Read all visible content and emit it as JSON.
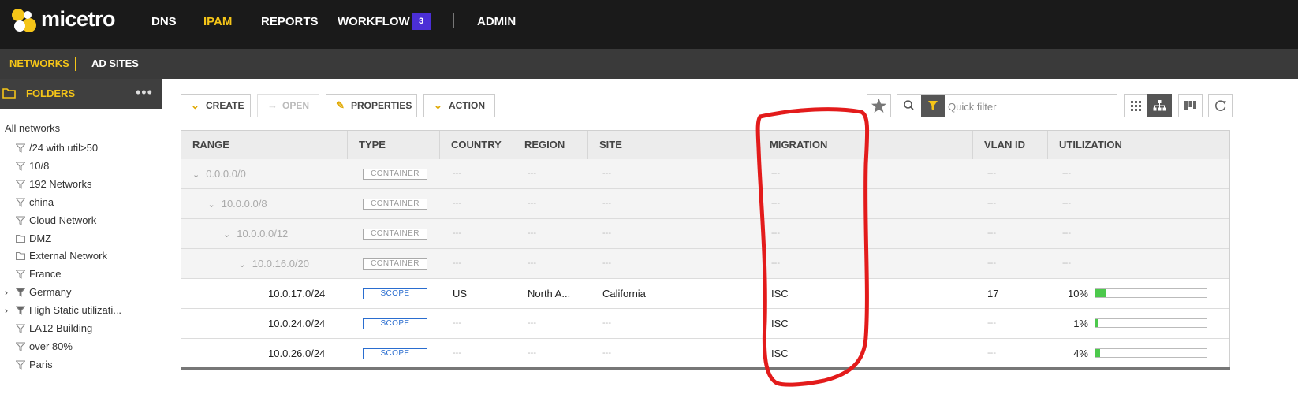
{
  "app": {
    "name": "micetro"
  },
  "nav": {
    "items": [
      "DNS",
      "IPAM",
      "REPORTS",
      "WORKFLOW",
      "ADMIN"
    ],
    "active": "IPAM",
    "workflow_badge": "3"
  },
  "subnav": {
    "items": [
      "NETWORKS",
      "AD SITES"
    ],
    "active": "NETWORKS"
  },
  "sidebar": {
    "header": "FOLDERS",
    "more": "•••",
    "root": "All networks",
    "items": [
      {
        "label": "/24 with util>50",
        "icon": "filter-icon",
        "expandable": false
      },
      {
        "label": "10/8",
        "icon": "filter-icon",
        "expandable": false
      },
      {
        "label": "192 Networks",
        "icon": "filter-icon",
        "expandable": false
      },
      {
        "label": "china",
        "icon": "filter-icon",
        "expandable": false
      },
      {
        "label": "Cloud Network",
        "icon": "filter-icon",
        "expandable": false
      },
      {
        "label": "DMZ",
        "icon": "folder-icon",
        "expandable": false
      },
      {
        "label": "External Network",
        "icon": "folder-icon",
        "expandable": false
      },
      {
        "label": "France",
        "icon": "filter-icon",
        "expandable": false
      },
      {
        "label": "Germany",
        "icon": "filter-icon",
        "expandable": true
      },
      {
        "label": "High Static utilizati...",
        "icon": "filter-icon",
        "expandable": true
      },
      {
        "label": "LA12 Building",
        "icon": "filter-icon",
        "expandable": false
      },
      {
        "label": "over 80%",
        "icon": "filter-icon",
        "expandable": false
      },
      {
        "label": "Paris",
        "icon": "filter-icon",
        "expandable": false
      }
    ]
  },
  "toolbar": {
    "create": "CREATE",
    "open": "OPEN",
    "properties": "PROPERTIES",
    "action": "ACTION",
    "quick_filter_placeholder": "Quick filter"
  },
  "table": {
    "columns": [
      "RANGE",
      "TYPE",
      "COUNTRY",
      "REGION",
      "SITE",
      "MIGRATION",
      "VLAN ID",
      "UTILIZATION"
    ],
    "rows": [
      {
        "range": "0.0.0.0/0",
        "type": "CONTAINER",
        "country": "---",
        "region": "---",
        "site": "---",
        "migration": "---",
        "vlan": "---",
        "utilization": "---",
        "util_value": null,
        "kind": "container",
        "depth": 0
      },
      {
        "range": "10.0.0.0/8",
        "type": "CONTAINER",
        "country": "---",
        "region": "---",
        "site": "---",
        "migration": "---",
        "vlan": "---",
        "utilization": "---",
        "util_value": null,
        "kind": "container",
        "depth": 1
      },
      {
        "range": "10.0.0.0/12",
        "type": "CONTAINER",
        "country": "---",
        "region": "---",
        "site": "---",
        "migration": "---",
        "vlan": "---",
        "utilization": "---",
        "util_value": null,
        "kind": "container",
        "depth": 2
      },
      {
        "range": "10.0.16.0/20",
        "type": "CONTAINER",
        "country": "---",
        "region": "---",
        "site": "---",
        "migration": "---",
        "vlan": "---",
        "utilization": "---",
        "util_value": null,
        "kind": "container",
        "depth": 3
      },
      {
        "range": "10.0.17.0/24",
        "type": "SCOPE",
        "country": "US",
        "region": "North A...",
        "site": "California",
        "migration": "ISC",
        "vlan": "17",
        "utilization": "10%",
        "util_value": 0.1,
        "kind": "scope",
        "depth": 4
      },
      {
        "range": "10.0.24.0/24",
        "type": "SCOPE",
        "country": "---",
        "region": "---",
        "site": "---",
        "migration": "ISC",
        "vlan": "---",
        "utilization": "1%",
        "util_value": 0.01,
        "kind": "scope",
        "depth": 4
      },
      {
        "range": "10.0.26.0/24",
        "type": "SCOPE",
        "country": "---",
        "region": "---",
        "site": "---",
        "migration": "ISC",
        "vlan": "---",
        "utilization": "4%",
        "util_value": 0.04,
        "kind": "scope",
        "depth": 4
      }
    ]
  },
  "colors": {
    "accent": "#f5c518",
    "topbar": "#1a1a1a",
    "subbar": "#3a3a3a",
    "badge": "#4b2fd6",
    "scope": "#2a6dcf",
    "util_fill": "#4cc94c",
    "annotation": "#e31b1b"
  }
}
